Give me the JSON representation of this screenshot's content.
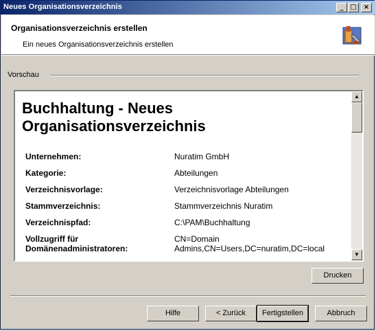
{
  "window": {
    "title": "Neues Organisationsverzeichnis"
  },
  "title_buttons": {
    "minimize": "_",
    "maximize": "□",
    "close": "×"
  },
  "header": {
    "title": "Organisationsverzeichnis erstellen",
    "subtitle": "Ein neues Organisationsverzeichnis erstellen",
    "icon": "wizard-icon"
  },
  "preview": {
    "group_label": "Vorschau",
    "doc_title": "Buchhaltung - Neues Organisationsverzeichnis",
    "rows": [
      {
        "key": "Unternehmen:",
        "value": "Nuratim GmbH"
      },
      {
        "key": "Kategorie:",
        "value": "Abteilungen"
      },
      {
        "key": "Verzeichnisvorlage:",
        "value": "Verzeichnisvorlage Abteilungen"
      },
      {
        "key": "Stammverzeichnis:",
        "value": "Stammverzeichnis Nuratim"
      },
      {
        "key": "Verzeichnispfad:",
        "value": "C:\\PAM\\Buchhaltung"
      },
      {
        "key": "Vollzugriff für Domänenadministratoren:",
        "value": "CN=Domain Admins,CN=Users,DC=nuratim,DC=local"
      }
    ]
  },
  "buttons": {
    "print": "Drucken",
    "help": "Hilfe",
    "back": "< Zurück",
    "finish": "Fertigstellen",
    "cancel": "Abbruch"
  }
}
